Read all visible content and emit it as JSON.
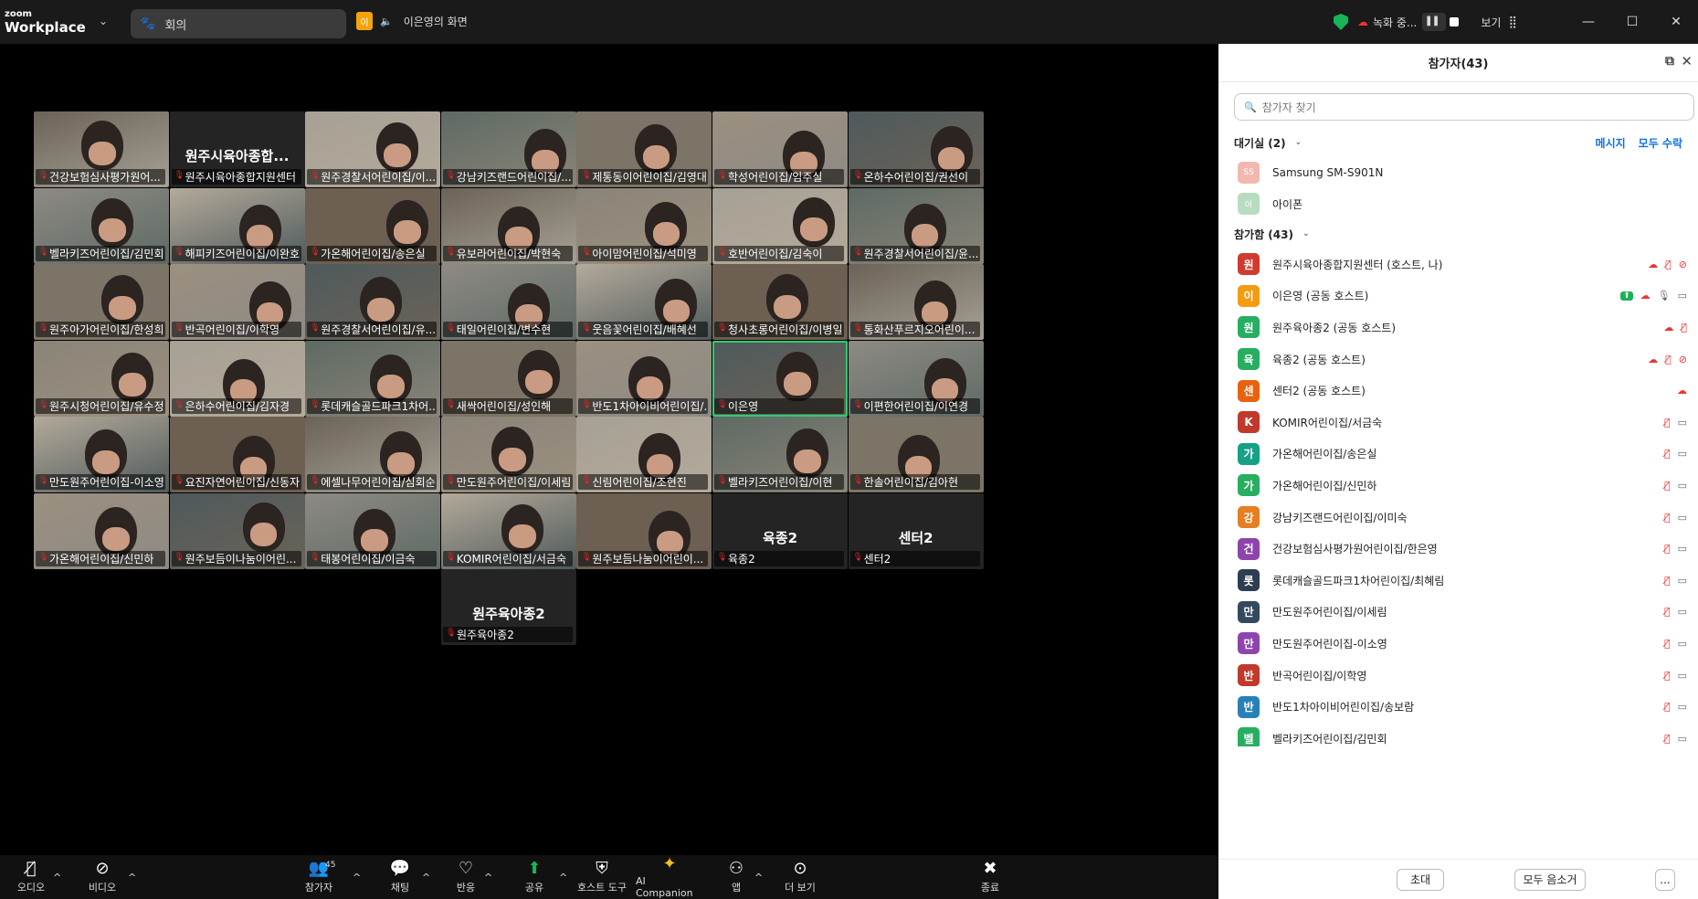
{
  "app": {
    "brand_small": "zoom",
    "brand_name": "Workplace"
  },
  "meeting": {
    "title": "회의",
    "speaker_initial": "이",
    "speaker_label": "이은영의 화면"
  },
  "topbar": {
    "recording": "녹화 중...",
    "view": "보기"
  },
  "tiles": [
    {
      "name": "건강보험심사평가원어...",
      "kind": "video"
    },
    {
      "name": "원주시육아종합지원센터",
      "kind": "blank",
      "big": "원주시육아종합..."
    },
    {
      "name": "원주경찰서어린이집/이...",
      "kind": "video"
    },
    {
      "name": "강남키즈랜드어린이집/...",
      "kind": "video"
    },
    {
      "name": "제통동이어린이집/김영대",
      "kind": "video"
    },
    {
      "name": "학성어린이집/임주실",
      "kind": "video"
    },
    {
      "name": "온하수어린이집/권선이",
      "kind": "video"
    },
    {
      "name": "벨라키즈어린이집/김민회",
      "kind": "video"
    },
    {
      "name": "해피키즈어린이집/이완호",
      "kind": "video"
    },
    {
      "name": "가온해어린이집/송은실",
      "kind": "video"
    },
    {
      "name": "유보라어린이집/박현숙",
      "kind": "video"
    },
    {
      "name": "아이맘어린이집/석미영",
      "kind": "video"
    },
    {
      "name": "호반어린이집/김숙이",
      "kind": "video"
    },
    {
      "name": "원주경찰서어린이집/윤...",
      "kind": "video"
    },
    {
      "name": "원주아가어린이집/한성희",
      "kind": "video"
    },
    {
      "name": "반곡어린이집/이학영",
      "kind": "video"
    },
    {
      "name": "원주경찰서어린이집/유...",
      "kind": "video"
    },
    {
      "name": "태일어린이집/변수현",
      "kind": "video"
    },
    {
      "name": "웃음꽃어린이집/배혜선",
      "kind": "video"
    },
    {
      "name": "청사초롱어린이집/이병일",
      "kind": "video"
    },
    {
      "name": "통화산푸르지오어린이...",
      "kind": "video"
    },
    {
      "name": "원주시청어린이집/유수정",
      "kind": "video"
    },
    {
      "name": "은하수어린이집/김자경",
      "kind": "video"
    },
    {
      "name": "롯데캐슬골드파크1차어...",
      "kind": "video"
    },
    {
      "name": "새싹어린이집/성인해",
      "kind": "video"
    },
    {
      "name": "반도1차아이비어린이집/...",
      "kind": "video"
    },
    {
      "name": "이은영",
      "kind": "video",
      "active": true
    },
    {
      "name": "이편한어린이집/이연경",
      "kind": "video"
    },
    {
      "name": "만도원주어린이집-이소영",
      "kind": "video"
    },
    {
      "name": "요진자연어린이집/신동자",
      "kind": "video"
    },
    {
      "name": "에셀나무어린이집/심회순",
      "kind": "video"
    },
    {
      "name": "만도원주어린이집/이세림",
      "kind": "video"
    },
    {
      "name": "신림어린이집/조현진",
      "kind": "video"
    },
    {
      "name": "벨라키즈어린이집/이현",
      "kind": "video"
    },
    {
      "name": "한솔어린이집/김아현",
      "kind": "video"
    },
    {
      "name": "가온해어린이집/신민하",
      "kind": "video"
    },
    {
      "name": "원주보듬이나눔이어린...",
      "kind": "video"
    },
    {
      "name": "태봉어린이집/이금숙",
      "kind": "video"
    },
    {
      "name": "KOMIR어린이집/서금숙",
      "kind": "video"
    },
    {
      "name": "원주보듬나눔이어린이...",
      "kind": "video"
    },
    {
      "name": "육종2",
      "kind": "blank",
      "big": "육종2"
    },
    {
      "name": "센터2",
      "kind": "blank",
      "big": "센터2"
    },
    {
      "name": "원주육아종2",
      "kind": "blank",
      "big": "원주육아종2"
    }
  ],
  "panel": {
    "title": "참가자(43)",
    "search_placeholder": "참가자 찾기",
    "waiting_label": "대기실 (2)",
    "message": "메시지",
    "admit_all": "모두 수락",
    "waiting": [
      {
        "initials": "SS",
        "name": "Samsung SM-S901N",
        "color": "#f2b8b0"
      },
      {
        "initials": "아",
        "name": "아이폰",
        "color": "#b8dcc0"
      }
    ],
    "joined_label": "참가함 (43)",
    "participants": [
      {
        "initial": "원",
        "name": "원주시육아종합지원센터 (호스트, 나)",
        "color": "#d03a2f",
        "icons": [
          "cloud",
          "mic-off",
          "cam-off"
        ]
      },
      {
        "initial": "이",
        "name": "이은영 (공동 호스트)",
        "color": "#f39c12",
        "icons": [
          "share",
          "cloud",
          "mic",
          "cam"
        ]
      },
      {
        "initial": "원",
        "name": "원주육아종2 (공동 호스트)",
        "color": "#27ae60",
        "icons": [
          "cloud",
          "mic-off"
        ]
      },
      {
        "initial": "육",
        "name": "육종2 (공동 호스트)",
        "color": "#27ae60",
        "icons": [
          "cloud",
          "mic-off",
          "cam-off"
        ]
      },
      {
        "initial": "센",
        "name": "센터2 (공동 호스트)",
        "color": "#e8620c",
        "icons": [
          "cloud"
        ]
      },
      {
        "initial": "K",
        "name": "KOMIR어린이집/서금숙",
        "color": "#c0392b",
        "icons": [
          "mic-off",
          "cam"
        ]
      },
      {
        "initial": "가",
        "name": "가온해어린이집/송은실",
        "color": "#16a085",
        "icons": [
          "mic-off",
          "cam"
        ]
      },
      {
        "initial": "가",
        "name": "가온해어린이집/신민하",
        "color": "#27ae60",
        "icons": [
          "mic-off",
          "cam"
        ]
      },
      {
        "initial": "강",
        "name": "강남키즈랜드어린이집/이미숙",
        "color": "#e67e22",
        "icons": [
          "mic-off",
          "cam"
        ]
      },
      {
        "initial": "건",
        "name": "건강보험심사평가원어린이집/한은영",
        "color": "#8e44ad",
        "icons": [
          "mic-off",
          "cam"
        ]
      },
      {
        "initial": "롯",
        "name": "롯데캐슬골드파크1차어린이집/최혜림",
        "color": "#2c3e50",
        "icons": [
          "mic-off",
          "cam"
        ]
      },
      {
        "initial": "만",
        "name": "만도원주어린이집/이세림",
        "color": "#34495e",
        "icons": [
          "mic-off",
          "cam"
        ]
      },
      {
        "initial": "만",
        "name": "만도원주어린이집-이소영",
        "color": "#8e44ad",
        "icons": [
          "mic-off",
          "cam"
        ]
      },
      {
        "initial": "반",
        "name": "반곡어린이집/이학영",
        "color": "#c0392b",
        "icons": [
          "mic-off",
          "cam"
        ]
      },
      {
        "initial": "반",
        "name": "반도1차아이비어린이집/송보람",
        "color": "#2980b9",
        "icons": [
          "mic-off",
          "cam"
        ]
      },
      {
        "initial": "벨",
        "name": "벨라키즈어린이집/김민회",
        "color": "#27ae60",
        "icons": [
          "mic-off",
          "cam"
        ]
      }
    ],
    "invite": "초대",
    "mute_all": "모두 음소거",
    "more": "..."
  },
  "toolbar": {
    "audio": "오디오",
    "video": "비디오",
    "participants": "참가자",
    "participants_count": "45",
    "chat": "채팅",
    "reactions": "반응",
    "share": "공유",
    "host_tools": "호스트 도구",
    "ai": "AI Companion",
    "apps": "앱",
    "more": "더 보기",
    "end": "종료"
  }
}
